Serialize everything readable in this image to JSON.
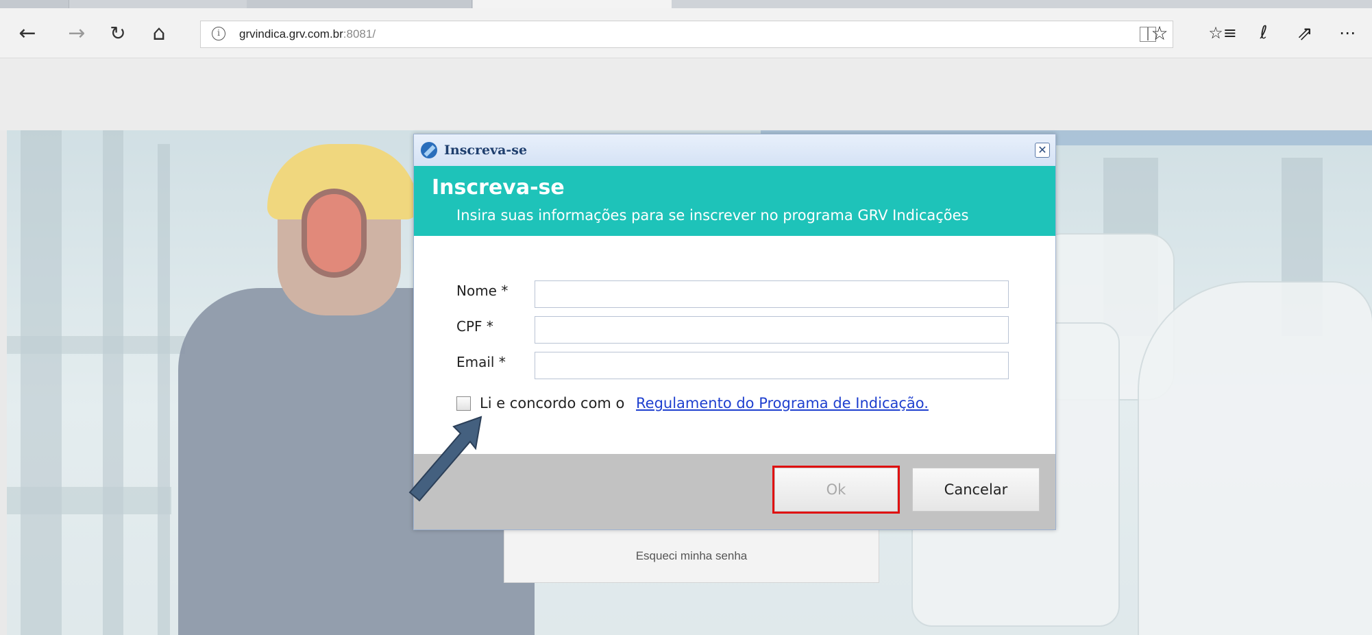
{
  "browser": {
    "url_host": "grvindica.grv.com.br",
    "url_port": ":8081/",
    "nav": {
      "back_icon": "back-arrow-icon",
      "forward_icon": "forward-arrow-icon",
      "refresh_icon": "refresh-icon",
      "home_icon": "home-icon"
    },
    "toolbar_icons": [
      "reading-view-icon",
      "favorite-star-icon",
      "favorites-hub-icon",
      "web-note-icon",
      "share-icon",
      "more-icon"
    ]
  },
  "page": {
    "forgot_password": "Esqueci minha senha"
  },
  "dialog": {
    "window_title": "Inscreva-se",
    "heading": "Inscreva-se",
    "subheading": "Insira suas informações para se inscrever no programa GRV Indicações",
    "fields": {
      "nome_label": "Nome *",
      "nome_value": "",
      "cpf_label": "CPF *",
      "cpf_value": "",
      "email_label": "Email *",
      "email_value": ""
    },
    "agree_text": "Li e concordo com o",
    "agree_link": "Regulamento do Programa de Indicação.",
    "agree_checked": false,
    "ok_label": "Ok",
    "cancel_label": "Cancelar"
  },
  "colors": {
    "header_teal": "#1ec3b9",
    "highlight_red": "#e01010",
    "arrow_fill": "#44607f",
    "link_blue": "#1e3fcf"
  }
}
